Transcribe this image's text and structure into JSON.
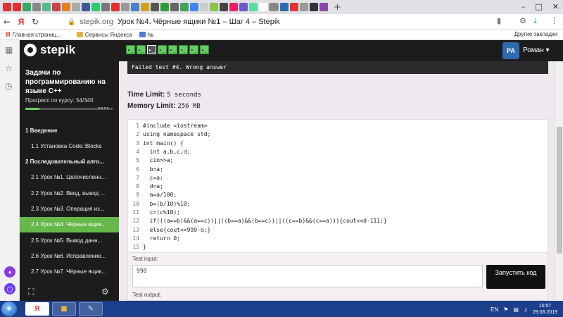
{
  "browser": {
    "url_host": "stepik.org",
    "url_dash": "–",
    "page_title": "Урок №4. Чёрные ящики №1 – Шаг 4 – Stepik",
    "new_tab_symbol": "+",
    "bookmarks": [
      {
        "label": "Главная страниц..."
      },
      {
        "label": "Сервисы Яндекса"
      },
      {
        "label": "№"
      }
    ],
    "other_bookmarks": "Другие закладки",
    "yandex_letter": "Я"
  },
  "header": {
    "logo_text": "stepik",
    "avatar_initials": "PA",
    "user_name": "Роман ▾",
    "steps_total": 8,
    "current_step": 3
  },
  "sidebar": {
    "course_title": "Задачи по программированию на языке C++",
    "progress_text": "Прогресс по курсу:  54/340",
    "progress_fraction": 0.159,
    "items": [
      {
        "label": "1  Введение",
        "type": "section"
      },
      {
        "label": "1.1  Установка Code::Blocks",
        "type": "lesson"
      },
      {
        "label": "2  Последовательный алго...",
        "type": "section"
      },
      {
        "label": "2.1  Урок №1. Целочисленн...",
        "type": "lesson"
      },
      {
        "label": "2.2  Урок №2. Ввод, вывод ...",
        "type": "lesson"
      },
      {
        "label": "2.3  Урок №3. Операция из...",
        "type": "lesson"
      },
      {
        "label": "2.4  Урок №4. Чёрные ящик...",
        "type": "lesson",
        "active": true
      },
      {
        "label": "2.5  Урок №5. Вывод данн...",
        "type": "lesson"
      },
      {
        "label": "2.6  Урок №6. Исправление...",
        "type": "lesson"
      },
      {
        "label": "2.7  Урок №7. Чёрные ящик...",
        "type": "lesson"
      }
    ]
  },
  "main": {
    "failed_message": "Failed test #4. Wrong answer",
    "time_limit_label": "Time Limit:",
    "time_limit_value": "5 seconds",
    "memory_limit_label": "Memory Limit:",
    "memory_limit_value": "256 MB",
    "code_lines": [
      "#include <iostream>",
      "using namespace std;",
      "int main() {",
      "  int a,b,c,d;",
      "  cin>>a;",
      "  b=a;",
      "  c=a;",
      "  d=a;",
      "  a=a/100;",
      "  b=(b/10)%10;",
      "  c=(c%10);",
      "  if(((a==b)&&(a==c))||((b==a)&&(b==c))||((c==b)&&(c==a))){cout<<d-111;}",
      "  else{cout<<999-d;}",
      "  return 0;",
      "}"
    ],
    "test_input_label": "Test input:",
    "test_input_value": "998",
    "run_button": "Запустить код",
    "test_output_label": "Test output:"
  },
  "taskbar": {
    "lang": "EN",
    "time": "10:57",
    "date": "29.06.2019"
  },
  "colors": {
    "accent_green": "#66b84a",
    "header_dark": "#1c1c1c",
    "page_bg": "#f0e8ef"
  }
}
